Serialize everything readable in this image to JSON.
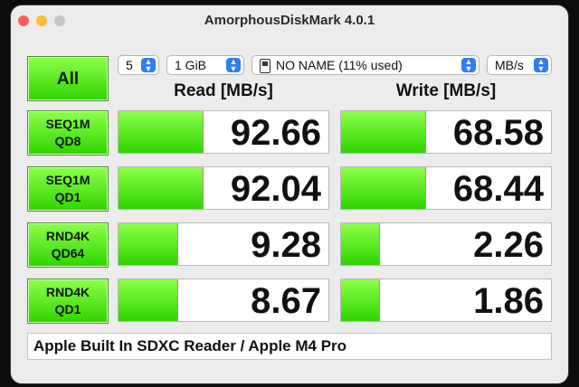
{
  "window": {
    "title": "AmorphousDiskMark 4.0.1"
  },
  "toolbar": {
    "all_label": "All",
    "count": "5",
    "size": "1 GiB",
    "drive": "NO NAME (11% used)",
    "unit": "MB/s"
  },
  "columns": {
    "read": "Read [MB/s]",
    "write": "Write [MB/s]"
  },
  "tests": [
    {
      "line1": "SEQ1M",
      "line2": "QD8",
      "read": "92.66",
      "write": "68.58",
      "read_fill": 0.4,
      "write_fill": 0.4
    },
    {
      "line1": "SEQ1M",
      "line2": "QD1",
      "read": "92.04",
      "write": "68.44",
      "read_fill": 0.4,
      "write_fill": 0.4
    },
    {
      "line1": "RND4K",
      "line2": "QD64",
      "read": "9.28",
      "write": "2.26",
      "read_fill": 0.28,
      "write_fill": 0.18
    },
    {
      "line1": "RND4K",
      "line2": "QD1",
      "read": "8.67",
      "write": "1.86",
      "read_fill": 0.28,
      "write_fill": 0.18
    }
  ],
  "status": {
    "device": "Apple Built In SDXC Reader / Apple M4 Pro"
  },
  "colors": {
    "bar_top": "#8dff4a",
    "bar_bottom": "#2fd400",
    "accent": "#2f7cf6"
  }
}
